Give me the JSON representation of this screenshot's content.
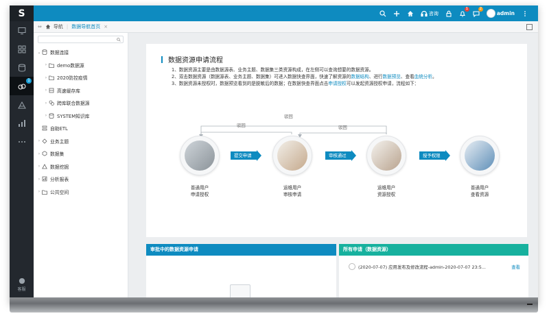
{
  "rail": {
    "logo": "S",
    "badge_count": "1",
    "bottom_label": "客服"
  },
  "topbar": {
    "consult_label": "咨询",
    "bell_badge": "1",
    "msg_badge": "2",
    "username": "admin"
  },
  "tabbar": {
    "nav_label": "导航",
    "active_tab": "数据导航首页",
    "close_glyph": "×"
  },
  "tree": {
    "items": [
      {
        "label": "数据连接",
        "arrow": "⌄",
        "icon": "database-icon"
      },
      {
        "label": "demo数据源",
        "arrow": "›",
        "icon": "folder-icon"
      },
      {
        "label": "2020防控疫情",
        "arrow": "›",
        "icon": "folder-icon"
      },
      {
        "label": "高速缓存库",
        "arrow": "›",
        "icon": "cache-icon"
      },
      {
        "label": "跨库联合数据源",
        "arrow": "›",
        "icon": "cross-db-icon"
      },
      {
        "label": "SYSTEM知识库",
        "arrow": "›",
        "icon": "database-icon"
      },
      {
        "label": "自助ETL",
        "arrow": "",
        "icon": "etl-icon"
      },
      {
        "label": "业务主题",
        "arrow": "›",
        "icon": "topic-icon"
      },
      {
        "label": "数据集",
        "arrow": "›",
        "icon": "dataset-icon"
      },
      {
        "label": "数据挖掘",
        "arrow": "›",
        "icon": "mining-icon"
      },
      {
        "label": "分析报表",
        "arrow": "›",
        "icon": "report-icon"
      },
      {
        "label": "公共空间",
        "arrow": "›",
        "icon": "folder-icon"
      }
    ]
  },
  "card": {
    "title": "数据资源申请流程",
    "lines": [
      {
        "parts": [
          "1、数据资源主要是由数据源表、业务主题、数据集三类资源构成，在左侧可以查询想要的数据资源。"
        ]
      },
      {
        "parts": [
          "2、双击数据资源（数据源表、业务主题、数据集）可进入数据快查界面，快速了解资源的",
          "数据结构",
          "、进行",
          "数据预览",
          "、查看",
          "血统分析",
          "。"
        ]
      },
      {
        "parts": [
          "3、数据资源未授权时，数据预览看到的是脱敏后的数据；在数据快查界面点击",
          "申请授权",
          "可以发起资源授权申请，流程如下："
        ]
      }
    ],
    "flow": {
      "nodes": [
        {
          "line1": "普通用户",
          "line2": "申请授权"
        },
        {
          "line1": "运维用户",
          "line2": "审核申请"
        },
        {
          "line1": "运维用户",
          "line2": "资源授权"
        },
        {
          "line1": "普通用户",
          "line2": "查看资源"
        }
      ],
      "arrows": [
        "提交申请",
        "审核通过",
        "授予权限"
      ],
      "rejects": [
        "驳回",
        "驳回",
        "驳回"
      ]
    }
  },
  "panels": {
    "left_title": "审批中的数据资源申请",
    "right_title": "所有申请（数据资源）",
    "right_row_text": "(2020-07-07) 应用发布及修改流程-admin-2020-07-07 23:5...",
    "right_row_action": "查看"
  },
  "colors": {
    "primary": "#0e8bc0",
    "teal": "#17b19e",
    "rail": "#23282e"
  }
}
